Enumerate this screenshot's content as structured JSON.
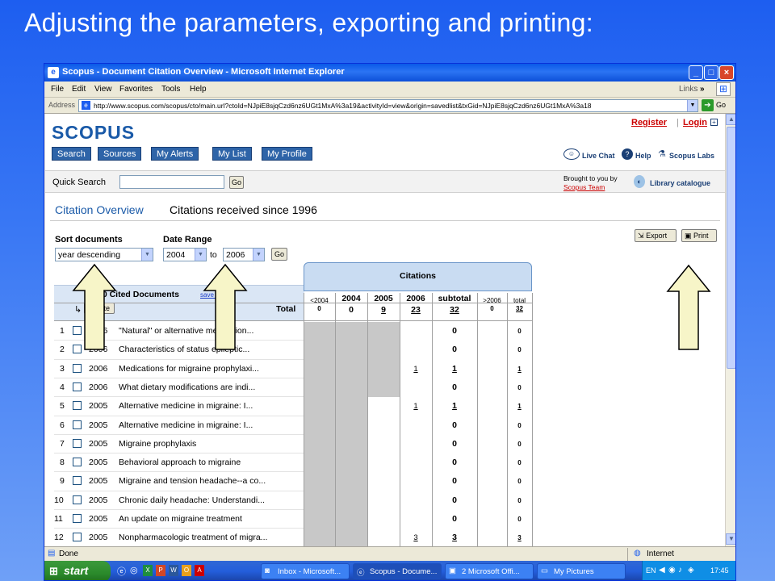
{
  "slide": {
    "title": "Adjusting the parameters, exporting and printing:"
  },
  "window": {
    "title": "Scopus - Document Citation Overview - Microsoft Internet Explorer",
    "buttons": {
      "minimize": "_",
      "maximize": "□",
      "close": "×"
    }
  },
  "menu": {
    "items": [
      "File",
      "Edit",
      "View",
      "Favorites",
      "Tools",
      "Help"
    ],
    "links_label": "Links"
  },
  "address": {
    "label": "Address",
    "url": "http://www.scopus.com/scopus/cto/main.url?ctoId=NJpiE8sjqCzd6nz6UGt1MxA%3a19&activityId=view&origin=savedlist&txGid=NJpiE8sjqCzd6nz6UGt1MxA%3a18",
    "go_label": "Go"
  },
  "scopus": {
    "logo": "SCOPUS",
    "nav": [
      "Search",
      "Sources",
      "My Alerts",
      "My List",
      "My Profile"
    ],
    "register": "Register",
    "separator": "|",
    "login": "Login",
    "live_chat": "Live Chat",
    "help": "Help",
    "labs": "Scopus Labs",
    "quick_search_label": "Quick Search",
    "quick_search_go": "Go",
    "brought_by": "Brought to you by",
    "scopus_team": "Scopus Team",
    "library_catalogue": "Library catalogue"
  },
  "overview": {
    "heading": "Citation Overview",
    "subheading": "Citations received since 1996",
    "sort_label": "Sort documents",
    "sort_value": "year descending",
    "date_label": "Date Range",
    "date_from": "2004",
    "date_to_word": "to",
    "date_to": "2006",
    "go": "Go",
    "export": "Export",
    "print": "Print"
  },
  "table": {
    "cited_docs_label": "20 Cited Documents",
    "save_to_list": "save to list",
    "delete": "Delete",
    "total_label": "Total",
    "citations_header": "Citations",
    "col_headers": [
      "<2004",
      "2004",
      "2005",
      "2006",
      "subtotal",
      ">2006",
      "total"
    ],
    "totals": [
      "0",
      "0",
      "9",
      "23",
      "32",
      "0",
      "32"
    ],
    "rows": [
      {
        "num": "1",
        "year": "2006",
        "title": "\"Natural\" or alternative medication...",
        "c2006": "",
        "subtotal": "0",
        "total": "0"
      },
      {
        "num": "2",
        "year": "2006",
        "title": "Characteristics of status epileptic...",
        "c2006": "",
        "subtotal": "0",
        "total": "0"
      },
      {
        "num": "3",
        "year": "2006",
        "title": "Medications for migraine prophylaxi...",
        "c2006": "1",
        "subtotal": "1",
        "total": "1"
      },
      {
        "num": "4",
        "year": "2006",
        "title": "What dietary modifications are indi...",
        "c2006": "",
        "subtotal": "0",
        "total": "0"
      },
      {
        "num": "5",
        "year": "2005",
        "title": "Alternative medicine in migraine: I...",
        "c2006": "1",
        "subtotal": "1",
        "total": "1"
      },
      {
        "num": "6",
        "year": "2005",
        "title": "Alternative medicine in migraine: I...",
        "c2006": "",
        "subtotal": "0",
        "total": "0"
      },
      {
        "num": "7",
        "year": "2005",
        "title": "Migraine prophylaxis",
        "c2006": "",
        "subtotal": "0",
        "total": "0"
      },
      {
        "num": "8",
        "year": "2005",
        "title": "Behavioral approach to migraine",
        "c2006": "",
        "subtotal": "0",
        "total": "0"
      },
      {
        "num": "9",
        "year": "2005",
        "title": "Migraine and tension headache--a co...",
        "c2006": "",
        "subtotal": "0",
        "total": "0"
      },
      {
        "num": "10",
        "year": "2005",
        "title": "Chronic daily headache: Understandi...",
        "c2006": "",
        "subtotal": "0",
        "total": "0"
      },
      {
        "num": "11",
        "year": "2005",
        "title": "An update on migraine treatment",
        "c2006": "",
        "subtotal": "0",
        "total": "0"
      },
      {
        "num": "12",
        "year": "2005",
        "title": "Nonpharmacologic treatment of migra...",
        "c2006": "3",
        "subtotal": "3",
        "total": "3"
      }
    ]
  },
  "status": {
    "left": "Done",
    "right": "Internet"
  },
  "taskbar": {
    "start": "start",
    "tasks": [
      "Inbox - Microsoft...",
      "Scopus - Docume...",
      "2 Microsoft Offi...",
      "My Pictures"
    ],
    "lang": "EN",
    "clock": "17:45"
  },
  "colors": {
    "accent": "#1a5aa8",
    "arrow_fill": "#f7f5c8",
    "citations_header_bg": "#c9dcf2"
  }
}
